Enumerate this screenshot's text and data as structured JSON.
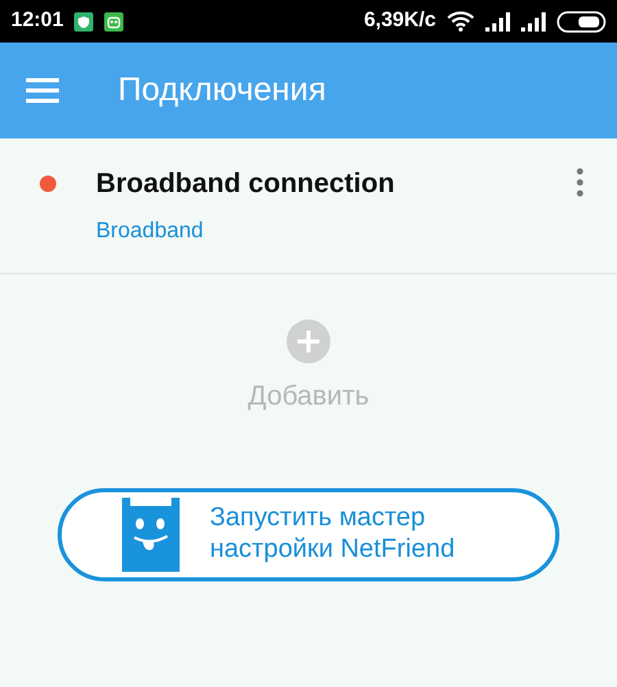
{
  "status_bar": {
    "time": "12:01",
    "speed": "6,39K/c"
  },
  "app_bar": {
    "title": "Подключения"
  },
  "connections": [
    {
      "name": "Broadband connection",
      "type": "Broadband",
      "color": "#f05a3c"
    }
  ],
  "add": {
    "label": "Добавить"
  },
  "wizard_button": {
    "label": "Запустить мастер настройки NetFriend"
  }
}
